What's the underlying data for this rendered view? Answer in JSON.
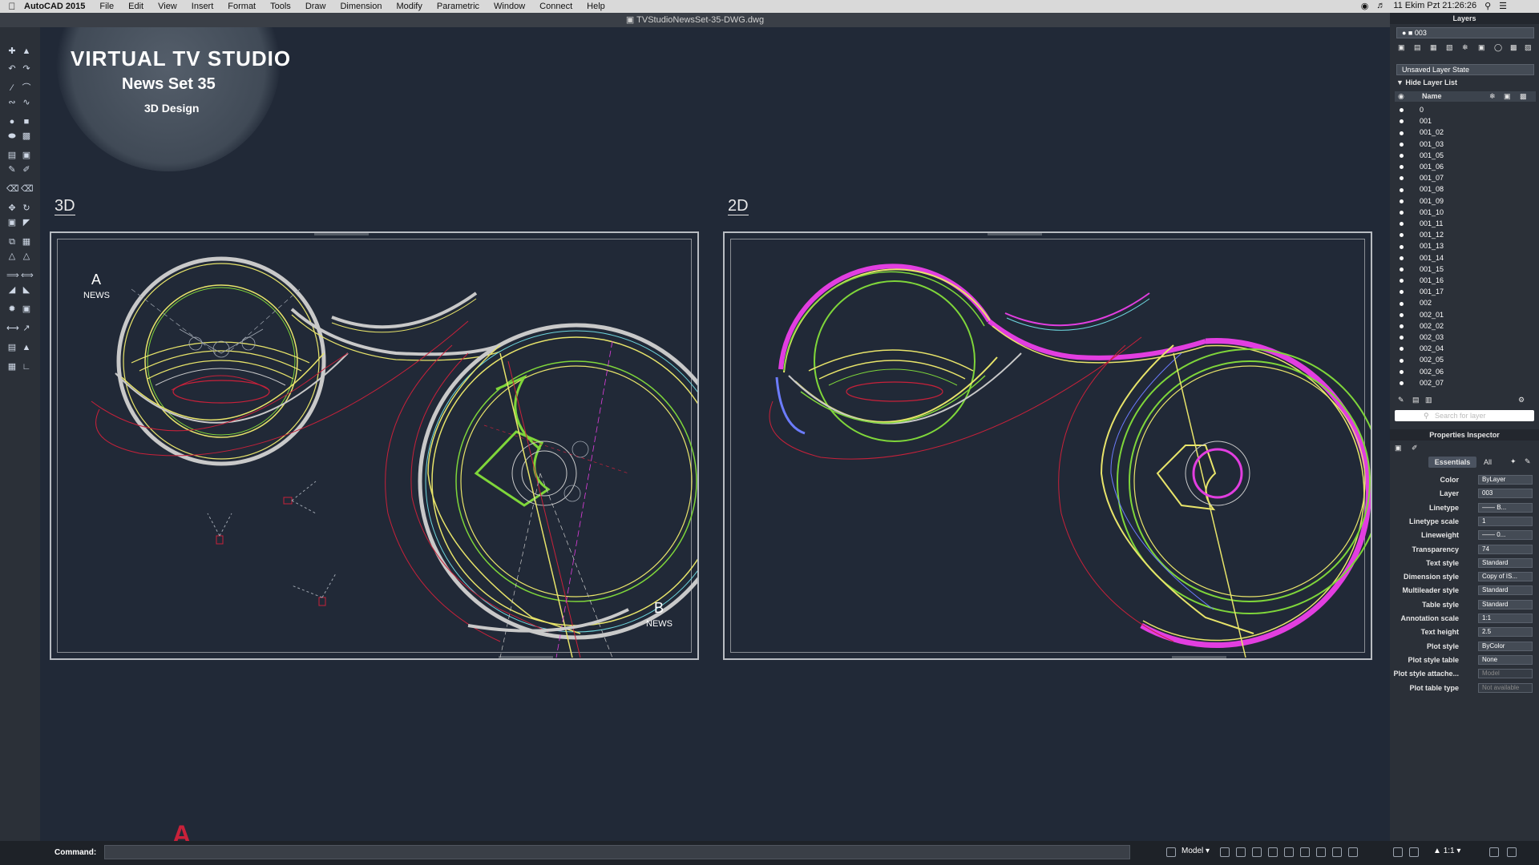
{
  "menubar": {
    "app_name": "AutoCAD 2015",
    "items": [
      "File",
      "Edit",
      "View",
      "Insert",
      "Format",
      "Tools",
      "Draw",
      "Dimension",
      "Modify",
      "Parametric",
      "Window",
      "Connect",
      "Help"
    ],
    "clock": "11 Ekim Pzt  21:26:26"
  },
  "titlebar": {
    "filename": "TVStudioNewsSet-35-DWG.dwg"
  },
  "watermark": {
    "title": "VIRTUAL TV STUDIO",
    "subtitle": "News Set 35",
    "caption": "3D Design"
  },
  "viewports": {
    "left_label": "3D",
    "right_label": "2D",
    "marker_a": "A",
    "marker_a_text": "NEWS",
    "marker_b": "B",
    "marker_b_text": "NEWS"
  },
  "layers_panel": {
    "title": "Layers",
    "current_layer": "003",
    "layer_state": "Unsaved Layer State",
    "hide_list_label": "Hide Layer List",
    "name_col": "Name",
    "layers": [
      "0",
      "001",
      "001_02",
      "001_03",
      "001_05",
      "001_06",
      "001_07",
      "001_08",
      "001_09",
      "001_10",
      "001_11",
      "001_12",
      "001_13",
      "001_14",
      "001_15",
      "001_16",
      "001_17",
      "002",
      "002_01",
      "002_02",
      "002_03",
      "002_04",
      "002_05",
      "002_06",
      "002_07"
    ],
    "search_placeholder": "Search for layer"
  },
  "properties_panel": {
    "title": "Properties Inspector",
    "tab_essentials": "Essentials",
    "tab_all": "All",
    "props": [
      {
        "label": "Color",
        "value": "ByLayer"
      },
      {
        "label": "Layer",
        "value": "003"
      },
      {
        "label": "Linetype",
        "value": "—— B..."
      },
      {
        "label": "Linetype scale",
        "value": "1"
      },
      {
        "label": "Lineweight",
        "value": "—— 0..."
      },
      {
        "label": "Transparency",
        "value": "74"
      },
      {
        "label": "Text style",
        "value": "Standard"
      },
      {
        "label": "Dimension style",
        "value": "Copy of IS..."
      },
      {
        "label": "Multileader style",
        "value": "Standard"
      },
      {
        "label": "Table style",
        "value": "Standard"
      },
      {
        "label": "Annotation scale",
        "value": "1:1"
      },
      {
        "label": "Text height",
        "value": "2.5"
      },
      {
        "label": "Plot style",
        "value": "ByColor"
      },
      {
        "label": "Plot style table",
        "value": "None"
      },
      {
        "label": "Plot style attache...",
        "value": "Model"
      },
      {
        "label": "Plot table type",
        "value": "Not available"
      }
    ]
  },
  "statusbar": {
    "command_label": "Command:",
    "model_tab": "Model",
    "scale": "1:1"
  },
  "colors": {
    "canvas": "#212937",
    "yellow": "#e8e46a",
    "green": "#7fd63a",
    "magenta": "#e23ee0",
    "red": "#c8213a",
    "cyan": "#6fd8e0"
  }
}
